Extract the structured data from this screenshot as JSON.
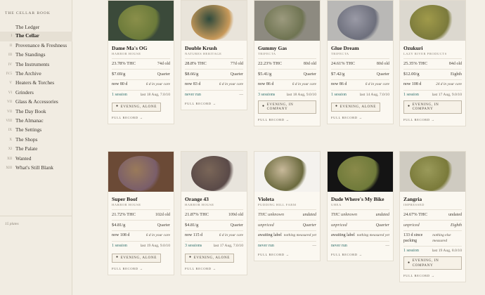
{
  "brand": "THE CELLAR BOOK",
  "nav": [
    {
      "num": "",
      "label": "The Ledger",
      "active": false
    },
    {
      "num": "I",
      "label": "The Cellar",
      "active": true
    },
    {
      "num": "II",
      "label": "Provenance & Freshness",
      "active": false
    },
    {
      "num": "III",
      "label": "The Standings",
      "active": false
    },
    {
      "num": "IV",
      "label": "The Instruments",
      "active": false
    },
    {
      "num": "IV.5",
      "label": "The Archive",
      "active": false
    },
    {
      "num": "V",
      "label": "Heaters & Torches",
      "active": false
    },
    {
      "num": "VI",
      "label": "Grinders",
      "active": false
    },
    {
      "num": "VII",
      "label": "Glass & Accessories",
      "active": false
    },
    {
      "num": "VII",
      "label": "The Day Book",
      "active": false
    },
    {
      "num": "VIII",
      "label": "The Almanac",
      "active": false
    },
    {
      "num": "IX",
      "label": "The Settings",
      "active": false
    },
    {
      "num": "X",
      "label": "The Shops",
      "active": false
    },
    {
      "num": "XI",
      "label": "The Palate",
      "active": false
    },
    {
      "num": "XII",
      "label": "Wanted",
      "active": false
    },
    {
      "num": "XIII",
      "label": "What's Still Blank",
      "active": false
    }
  ],
  "footer": "15 plates",
  "cards": [
    {
      "title": "Dame Ma's OG",
      "maker": "HARBOR HOUSE",
      "thc": "23.78% THC",
      "age": "74d old",
      "price": "$7.69/g",
      "unit": "Quarter",
      "status": "now 80 d",
      "status_note": "6 d in your care",
      "session": "1 session",
      "session_note": "last 18 Aug, 7.0/10",
      "tag": "EVENING, ALONE",
      "full": "FULL RECORD →",
      "photo": {
        "bg": "#3b4a3a",
        "bud": "#6b7a3a",
        "bud2": "#8a8f4a"
      }
    },
    {
      "title": "Double Krush",
      "maker": "NATURES HERITAGE",
      "thc": "28.8% THC",
      "age": "77d old",
      "price": "$8.66/g",
      "unit": "Quarter",
      "status": "now 83 d",
      "status_note": "6 d in your care",
      "session": "never run",
      "session_note": "—",
      "tag": "",
      "full": "FULL RECORD →",
      "photo": {
        "bg": "#e9e4da",
        "bud": "#c99a5a",
        "bud2": "#2f4a3c"
      }
    },
    {
      "title": "Gummy Gas",
      "maker": "TRIFECTA",
      "thc": "22.23% THC",
      "age": "80d old",
      "price": "$5.41/g",
      "unit": "Quarter",
      "status": "now 86 d",
      "status_note": "6 d in your care",
      "session": "3 sessions",
      "session_note": "last 18 Aug, 9.0/10",
      "tag": "EVENING, IN COMPANY",
      "full": "FULL RECORD →",
      "photo": {
        "bg": "#8d8a80",
        "bud": "#6f7452",
        "bud2": "#9c9a7e"
      }
    },
    {
      "title": "Glue Dream",
      "maker": "TRIFECTA",
      "thc": "24.61% THC",
      "age": "80d old",
      "price": "$7.42/g",
      "unit": "Quarter",
      "status": "now 86 d",
      "status_note": "6 d in your care",
      "session": "1 session",
      "session_note": "last 14 Aug, 7.0/10",
      "tag": "EVENING, ALONE",
      "full": "FULL RECORD →",
      "photo": {
        "bg": "#b9b8b6",
        "bud": "#6d6f7c",
        "bud2": "#9a9aa6"
      }
    },
    {
      "title": "Ozukuri",
      "maker": "LAZY RIVER PRODUCTS",
      "thc": "25.35% THC",
      "age": "84d old",
      "price": "$12.00/g",
      "unit": "Eighth",
      "status": "now 108 d",
      "status_note": "24 d in your care",
      "session": "1 session",
      "session_note": "last 17 Aug, 9.0/10",
      "tag": "EVENING, IN COMPANY",
      "full": "FULL RECORD →",
      "photo": {
        "bg": "#dcd8cf",
        "bud": "#7b7a3c",
        "bud2": "#a09a4a"
      }
    },
    {
      "title": "Super Boof",
      "maker": "HARBOR HOUSE",
      "thc": "21.72% THC",
      "age": "102d old",
      "price": "$4.81/g",
      "unit": "Quarter",
      "status": "now 108 d",
      "status_note": "6 d in your care",
      "session": "1 session",
      "session_note": "last 19 Aug, 9.0/10",
      "tag": "EVENING, ALONE",
      "full": "FULL RECORD →",
      "photo": {
        "bg": "#6b4a36",
        "bud": "#7a5e6a",
        "bud2": "#9a7a5a"
      }
    },
    {
      "title": "Orange 43",
      "maker": "HARBOR HOUSE",
      "thc": "21.87% THC",
      "age": "109d old",
      "price": "$4.81/g",
      "unit": "Quarter",
      "status": "now 115 d",
      "status_note": "6 d in your care",
      "session": "3 sessions",
      "session_note": "last 17 Aug, 7.0/10",
      "tag": "EVENING, ALONE",
      "full": "FULL RECORD →",
      "photo": {
        "bg": "#e8e4dc",
        "bud": "#5a4a48",
        "bud2": "#7a6658"
      }
    },
    {
      "title": "Violeta",
      "maker": "PUDDING HILL FARM",
      "thc": "THC unknown",
      "age": "undated",
      "price": "unpriced",
      "unit": "Quarter",
      "status": "awaiting label",
      "status_note": "nothing measured yet",
      "session": "never run",
      "session_note": "—",
      "tag": "",
      "full": "FULL RECORD →",
      "photo": {
        "bg": "#f4f2ee",
        "bud": "#6b6a3e",
        "bud2": "#c8b99a"
      }
    },
    {
      "title": "Dude Where's My Bike",
      "maker": "UHEA",
      "thc": "THC unknown",
      "age": "undated",
      "price": "unpriced",
      "unit": "Quarter",
      "status": "awaiting label",
      "status_note": "nothing measured yet",
      "session": "never run",
      "session_note": "—",
      "tag": "",
      "full": "FULL RECORD →",
      "photo": {
        "bg": "#141414",
        "bud": "#6f7a3a",
        "bud2": "#8a8a4a"
      }
    },
    {
      "title": "Zangria",
      "maker": "IMPRESSED",
      "thc": "24.67% THC",
      "age": "undated",
      "price": "unpriced",
      "unit": "Eighth",
      "status": "133 d since packing",
      "status_note": "nothing else measured",
      "session": "1 session",
      "session_note": "last 19 Aug, 8.0/10",
      "tag": "EVENING, IN COMPANY",
      "full": "FULL RECORD →",
      "photo": {
        "bg": "#cfcbc1",
        "bud": "#7a7a3a",
        "bud2": "#9a9a5a"
      }
    }
  ]
}
